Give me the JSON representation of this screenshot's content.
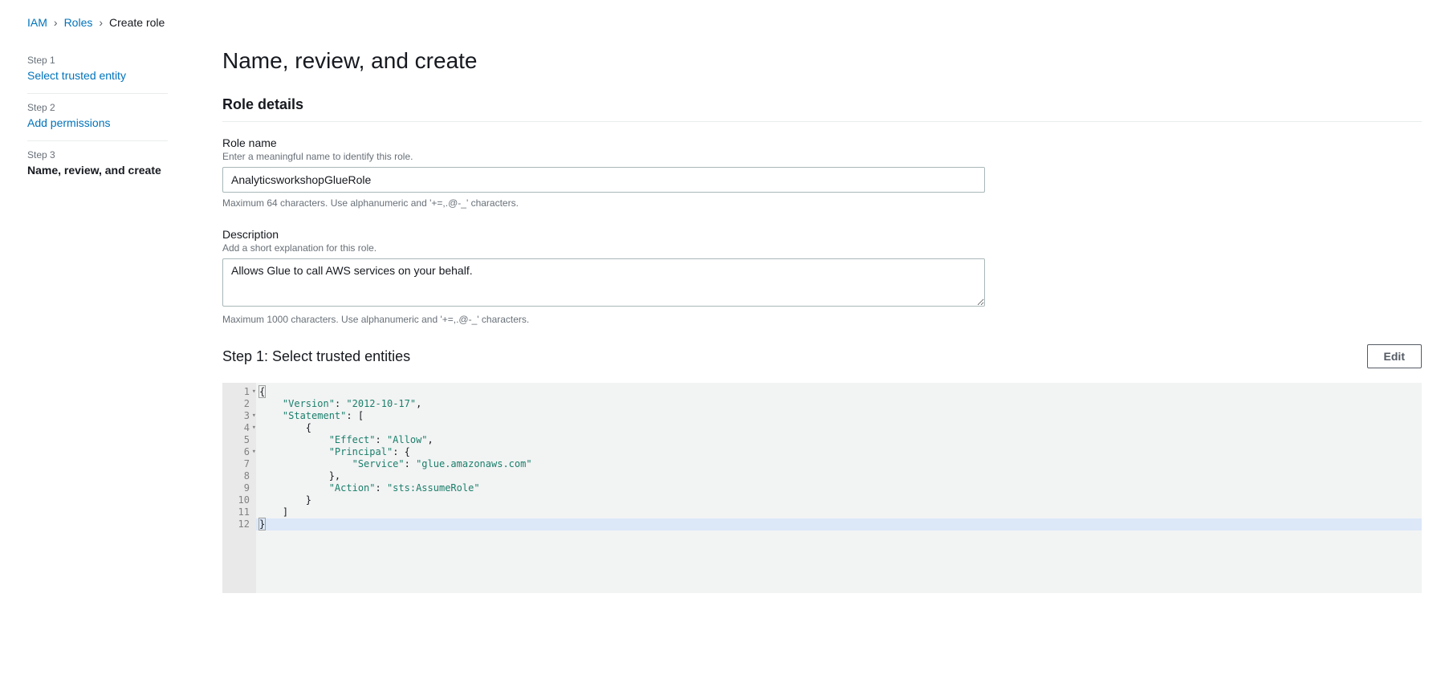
{
  "breadcrumb": {
    "items": [
      {
        "label": "IAM",
        "link": true
      },
      {
        "label": "Roles",
        "link": true
      },
      {
        "label": "Create role",
        "link": false
      }
    ]
  },
  "wizard": {
    "steps": [
      {
        "num": "Step 1",
        "label": "Select trusted entity",
        "state": "link"
      },
      {
        "num": "Step 2",
        "label": "Add permissions",
        "state": "link"
      },
      {
        "num": "Step 3",
        "label": "Name, review, and create",
        "state": "current"
      }
    ]
  },
  "page": {
    "title": "Name, review, and create"
  },
  "roleDetails": {
    "heading": "Role details",
    "name": {
      "label": "Role name",
      "hint": "Enter a meaningful name to identify this role.",
      "value": "AnalyticsworkshopGlueRole",
      "constraint": "Maximum 64 characters. Use alphanumeric and '+=,.@-_' characters."
    },
    "description": {
      "label": "Description",
      "hint": "Add a short explanation for this role.",
      "value": "Allows Glue to call AWS services on your behalf.",
      "constraint": "Maximum 1000 characters. Use alphanumeric and '+=,.@-_' characters."
    }
  },
  "trustedEntities": {
    "heading": "Step 1: Select trusted entities",
    "editLabel": "Edit",
    "policy": {
      "Version": "2012-10-17",
      "Statement": [
        {
          "Effect": "Allow",
          "Principal": {
            "Service": "glue.amazonaws.com"
          },
          "Action": "sts:AssumeRole"
        }
      ]
    },
    "lines": [
      {
        "n": 1,
        "fold": true,
        "indent": 0,
        "tokens": [
          [
            "brace",
            "{"
          ]
        ]
      },
      {
        "n": 2,
        "fold": false,
        "indent": 1,
        "tokens": [
          [
            "key",
            "\"Version\""
          ],
          [
            "punc",
            ": "
          ],
          [
            "str",
            "\"2012-10-17\""
          ],
          [
            "punc",
            ","
          ]
        ]
      },
      {
        "n": 3,
        "fold": true,
        "indent": 1,
        "tokens": [
          [
            "key",
            "\"Statement\""
          ],
          [
            "punc",
            ": ["
          ]
        ]
      },
      {
        "n": 4,
        "fold": true,
        "indent": 2,
        "tokens": [
          [
            "brace",
            "{"
          ]
        ]
      },
      {
        "n": 5,
        "fold": false,
        "indent": 3,
        "tokens": [
          [
            "key",
            "\"Effect\""
          ],
          [
            "punc",
            ": "
          ],
          [
            "str",
            "\"Allow\""
          ],
          [
            "punc",
            ","
          ]
        ]
      },
      {
        "n": 6,
        "fold": true,
        "indent": 3,
        "tokens": [
          [
            "key",
            "\"Principal\""
          ],
          [
            "punc",
            ": {"
          ]
        ]
      },
      {
        "n": 7,
        "fold": false,
        "indent": 4,
        "tokens": [
          [
            "key",
            "\"Service\""
          ],
          [
            "punc",
            ": "
          ],
          [
            "str",
            "\"glue.amazonaws.com\""
          ]
        ]
      },
      {
        "n": 8,
        "fold": false,
        "indent": 3,
        "tokens": [
          [
            "punc",
            "},"
          ]
        ]
      },
      {
        "n": 9,
        "fold": false,
        "indent": 3,
        "tokens": [
          [
            "key",
            "\"Action\""
          ],
          [
            "punc",
            ": "
          ],
          [
            "str",
            "\"sts:AssumeRole\""
          ]
        ]
      },
      {
        "n": 10,
        "fold": false,
        "indent": 2,
        "tokens": [
          [
            "brace",
            "}"
          ]
        ]
      },
      {
        "n": 11,
        "fold": false,
        "indent": 1,
        "tokens": [
          [
            "punc",
            "]"
          ]
        ]
      },
      {
        "n": 12,
        "fold": false,
        "indent": 0,
        "tokens": [
          [
            "brace",
            "}"
          ]
        ],
        "highlight": true
      }
    ]
  }
}
